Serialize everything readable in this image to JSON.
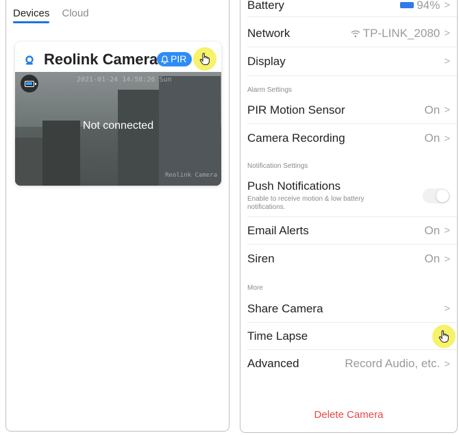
{
  "left": {
    "tabs": [
      {
        "label": "Devices",
        "active": true
      },
      {
        "label": "Cloud",
        "active": false
      }
    ],
    "card": {
      "camera_name": "Reolink Camera",
      "pir_label": "PIR",
      "status_text": "Not connected",
      "timestamp": "2021-01-24 14:58:26 Sun",
      "watermark": "Reolink Camera"
    }
  },
  "right": {
    "rows": {
      "battery": {
        "label": "Battery",
        "value": "94%"
      },
      "network": {
        "label": "Network",
        "value": "TP-LINK_2080"
      },
      "display": {
        "label": "Display"
      },
      "pir": {
        "label": "PIR Motion Sensor",
        "value": "On"
      },
      "recording": {
        "label": "Camera Recording",
        "value": "On"
      },
      "push": {
        "label": "Push Notifications",
        "sub": "Enable to receive motion & low battery notifications."
      },
      "email": {
        "label": "Email Alerts",
        "value": "On"
      },
      "siren": {
        "label": "Siren",
        "value": "On"
      },
      "share": {
        "label": "Share Camera"
      },
      "timelapse": {
        "label": "Time Lapse"
      },
      "advanced": {
        "label": "Advanced",
        "value": "Record Audio, etc."
      }
    },
    "sections": {
      "alarm": "Alarm Settings",
      "notification": "Notification Settings",
      "more": "More"
    },
    "delete_label": "Delete Camera",
    "chevron": ">"
  },
  "colors": {
    "accent": "#2f8cf5",
    "danger": "#e64747",
    "cursor_highlight": "#f6f26a"
  },
  "icons": [
    "camera-icon",
    "bell-icon",
    "hand-cursor-icon",
    "battery-icon",
    "wifi-icon",
    "chevron-right-icon"
  ]
}
